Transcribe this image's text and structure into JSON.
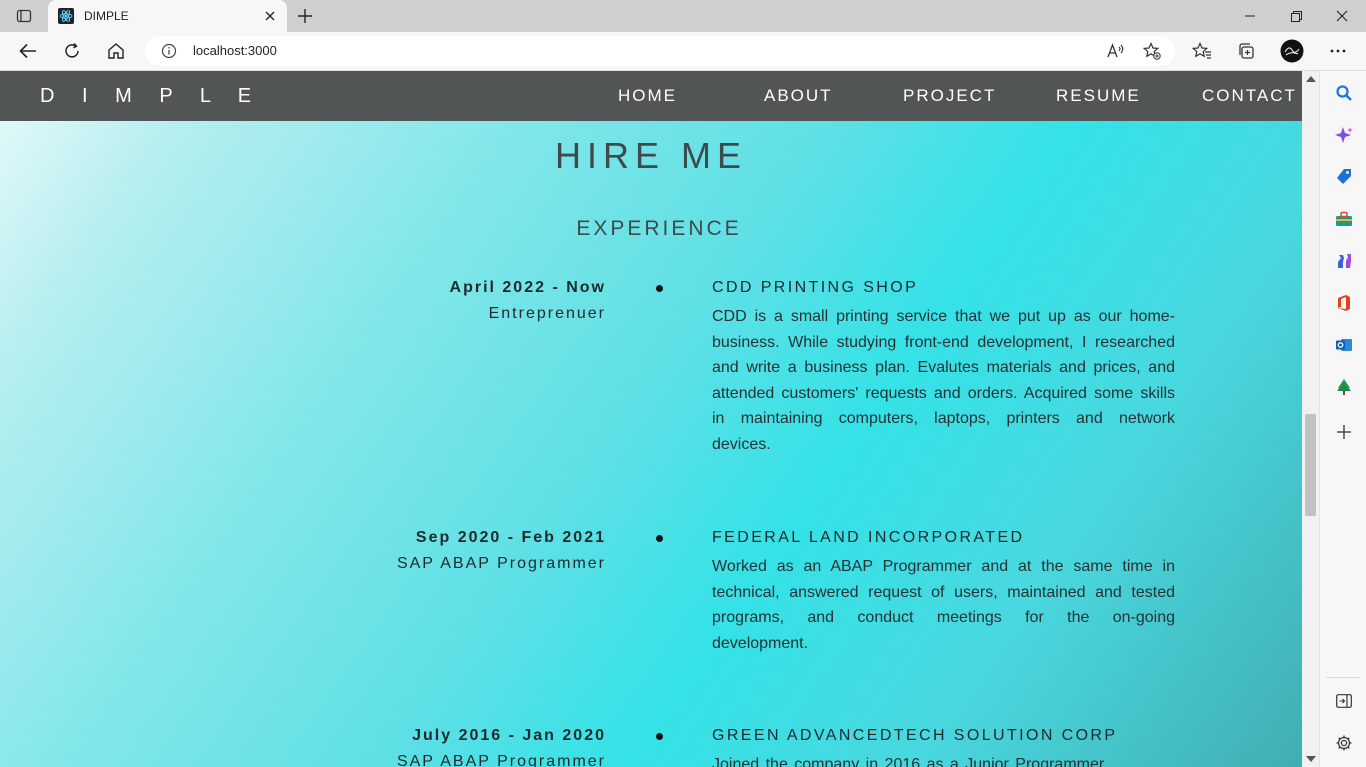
{
  "browser": {
    "tab_title": "DIMPLE",
    "url": "localhost:3000"
  },
  "site": {
    "brand": "DIMPLE",
    "brand_spaced": "D I M P L E",
    "nav": [
      "HOME",
      "ABOUT",
      "PROJECT",
      "RESUME",
      "CONTACT"
    ]
  },
  "resume": {
    "heading": "HIRE ME",
    "section": "EXPERIENCE",
    "entries": [
      {
        "date": "April 2022 - Now",
        "role": "Entreprenuer",
        "company": "CDD PRINTING SHOP",
        "description": "CDD is a small printing service that we put up as our home-business. While studying front-end development, I researched and write a business plan. Evalutes materials and prices, and attended customers' requests and orders. Acquired some skills in maintaining computers, laptops, printers and network devices."
      },
      {
        "date": "Sep 2020 - Feb 2021",
        "role": "SAP ABAP Programmer",
        "company": "FEDERAL LAND INCORPORATED",
        "description": "Worked as an ABAP Programmer and at the same time in technical, answered request of users, maintained and tested programs, and conduct meetings for the on-going development."
      },
      {
        "date": "July 2016 - Jan 2020",
        "role": "SAP ABAP Programmer",
        "company": "GREEN ADVANCEDTECH SOLUTION CORP",
        "description": "Joined the company in 2016 as a Junior Programmer"
      }
    ]
  },
  "icons": {
    "tab_actions": "tab-actions-icon",
    "favicon": "react-favicon-icon",
    "close": "close-icon",
    "new_tab": "plus-icon",
    "back": "back-arrow-icon",
    "refresh": "refresh-icon",
    "home": "home-icon",
    "info": "info-icon",
    "read_aloud": "read-aloud-icon",
    "add_favorite": "add-favorite-icon",
    "favorites": "favorites-icon",
    "collections": "collections-icon",
    "profile": "profile-avatar-icon",
    "more": "more-icon",
    "sidebar": [
      "search-icon",
      "copilot-icon",
      "shopping-tag-icon",
      "tools-icon",
      "games-icon",
      "office-icon",
      "outlook-icon",
      "tree-icon",
      "add-icon",
      "sidebar-toggle-icon",
      "settings-icon"
    ]
  },
  "colors": {
    "nav_bg": "#525555",
    "heading": "#3f4a4c",
    "accent_cyan": "#34e2e7"
  }
}
